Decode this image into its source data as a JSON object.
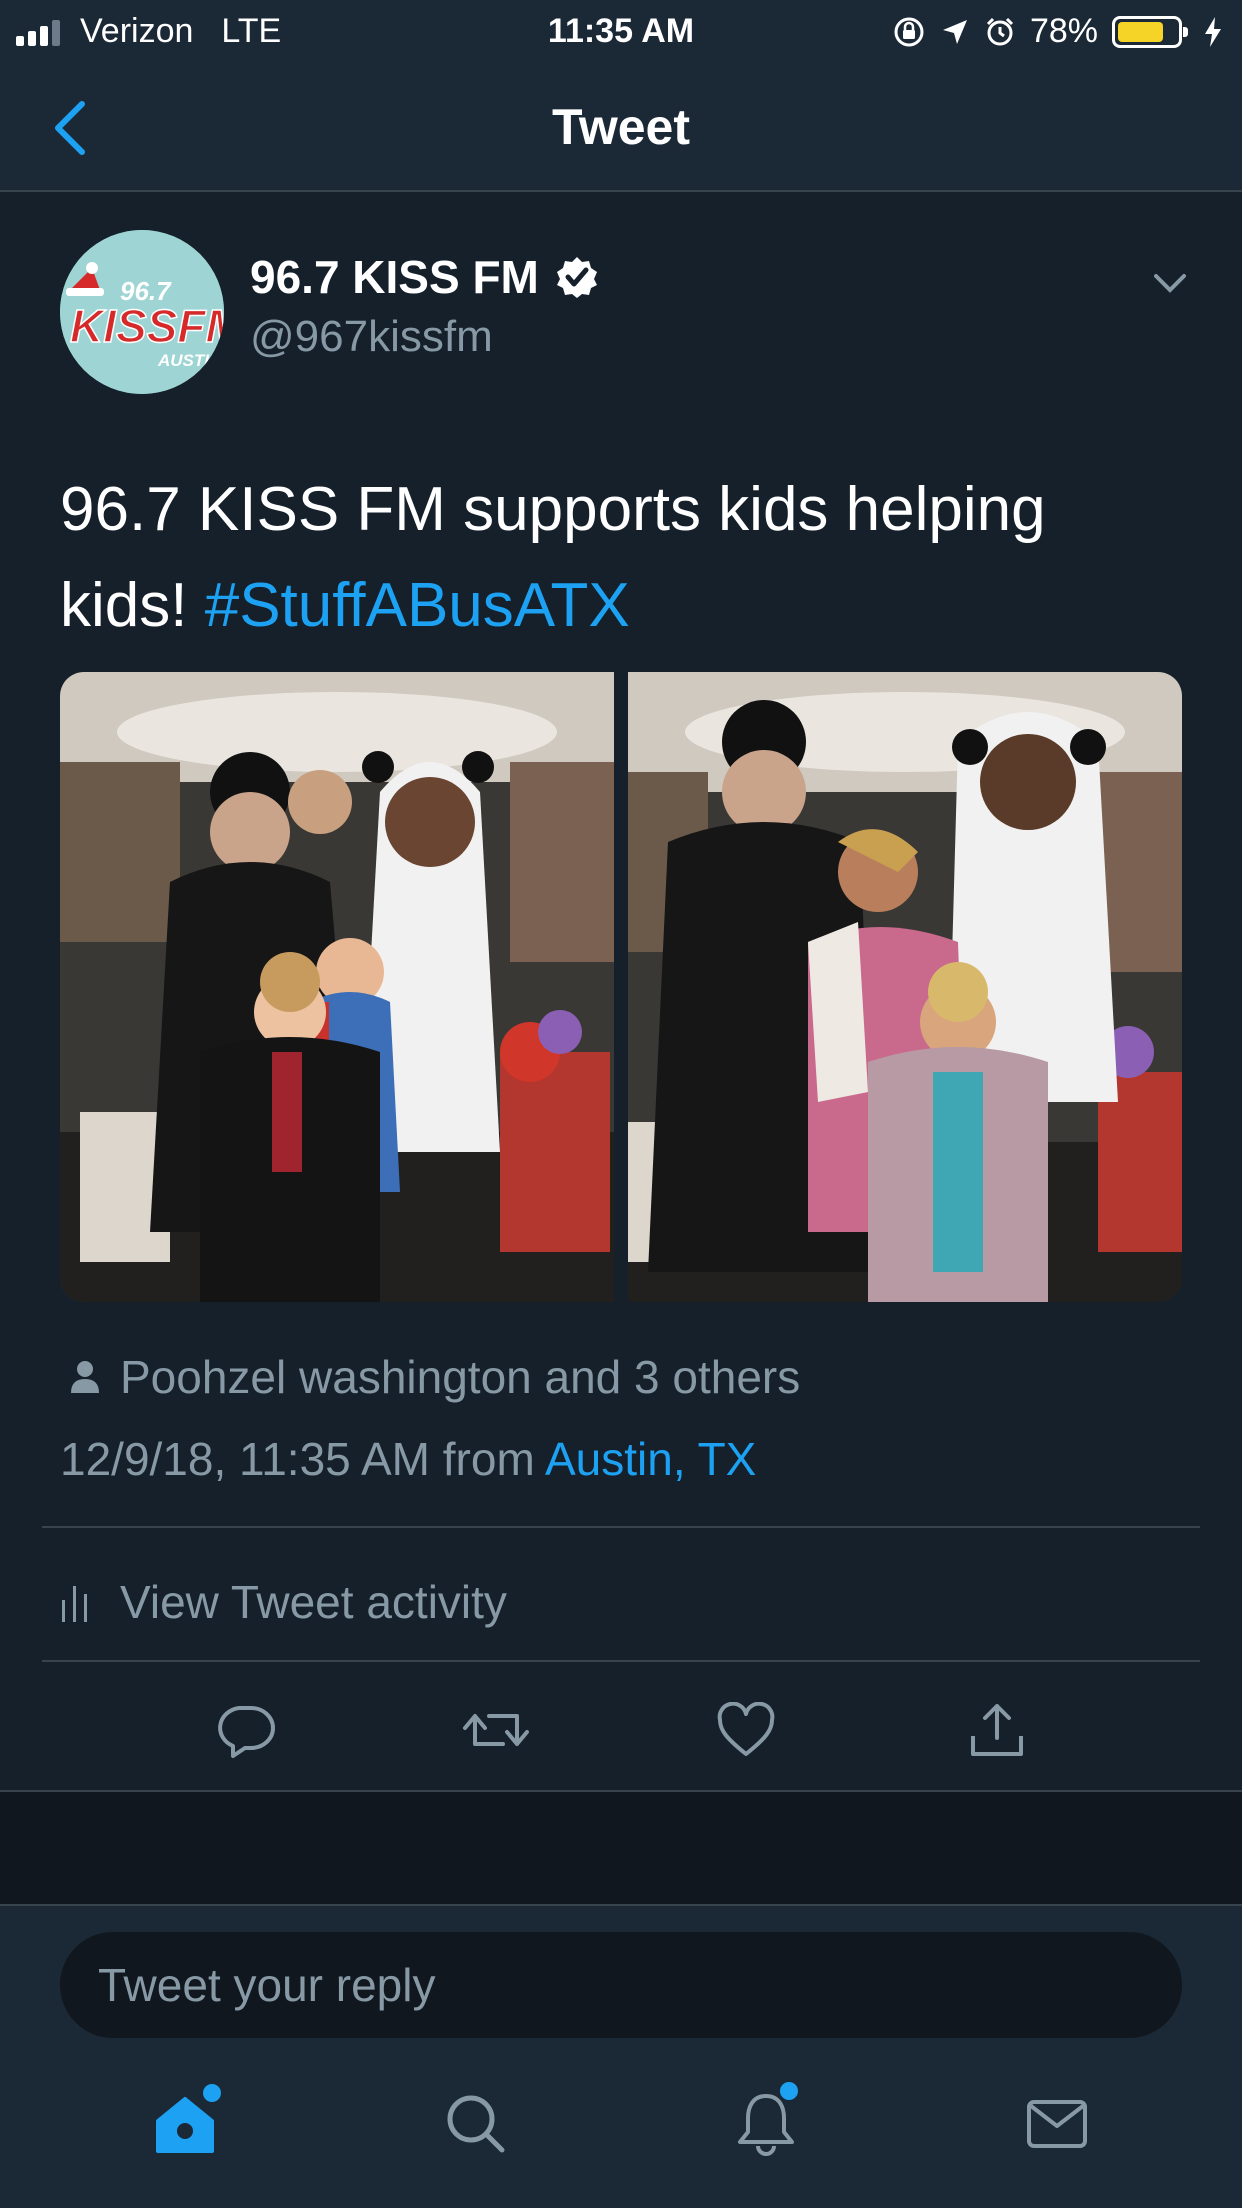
{
  "status_bar": {
    "carrier": "Verizon",
    "network": "LTE",
    "time": "11:35 AM",
    "battery": "78%",
    "battery_level": 0.78
  },
  "nav": {
    "title": "Tweet",
    "back_icon": "chevron-left-icon"
  },
  "tweet": {
    "avatar_text_top": "96.7",
    "avatar_text_main": "KISSFM",
    "avatar_text_sub": "AUSTIN",
    "display_name": "96.7 KISS FM",
    "handle": "@967kissfm",
    "text": "96.7 KISS FM supports kids helping kids! ",
    "hashtag": "#StuffABusATX",
    "likes_summary": "Poohzel washington and 3 others",
    "timestamp": "12/9/18, 11:35 AM from ",
    "location": "Austin, TX",
    "activity_label": "View Tweet activity"
  },
  "reply": {
    "placeholder": "Tweet your reply"
  },
  "colors": {
    "accent": "#1da1f2",
    "background": "#15202b",
    "muted": "#8899a6"
  }
}
